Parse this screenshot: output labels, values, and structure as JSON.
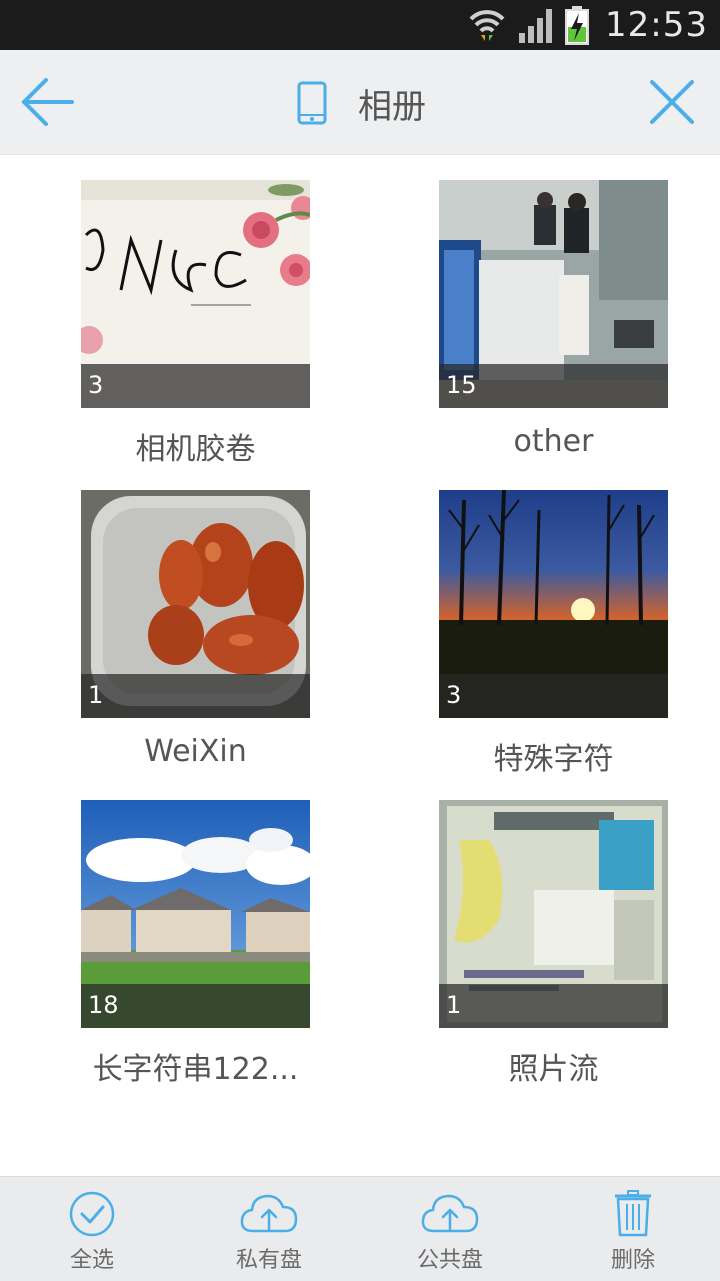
{
  "status_bar": {
    "time": "12:53"
  },
  "header": {
    "title": "相册"
  },
  "albums": [
    {
      "name": "相机胶卷",
      "count": "3"
    },
    {
      "name": "other",
      "count": "15"
    },
    {
      "name": "WeiXin",
      "count": "1"
    },
    {
      "name": "特殊字符",
      "count": "3"
    },
    {
      "name": "长字符串122...",
      "count": "18"
    },
    {
      "name": "照片流",
      "count": "1"
    }
  ],
  "toolbar": {
    "select_all": "全选",
    "private_disk": "私有盘",
    "public_disk": "公共盘",
    "delete": "删除"
  },
  "colors": {
    "accent": "#4aaee8",
    "header_bg": "#eeeff1",
    "toolbar_bg": "#eaebed"
  }
}
